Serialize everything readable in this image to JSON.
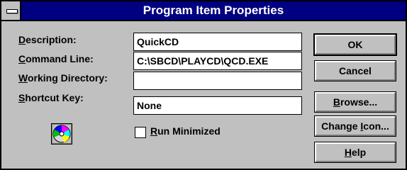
{
  "window": {
    "title": "Program Item Properties"
  },
  "labels": {
    "description": {
      "prefix": "",
      "hotkey": "D",
      "suffix": "escription:"
    },
    "command_line": {
      "prefix": "",
      "hotkey": "C",
      "suffix": "ommand Line:"
    },
    "working_directory": {
      "prefix": "",
      "hotkey": "W",
      "suffix": "orking Directory:"
    },
    "shortcut_key": {
      "prefix": "",
      "hotkey": "S",
      "suffix": "hortcut Key:"
    }
  },
  "fields": {
    "description": "QuickCD",
    "command_line": "C:\\SBCD\\PLAYCD\\QCD.EXE",
    "working_directory": "",
    "shortcut_key": "None"
  },
  "checkbox": {
    "checked": false,
    "prefix": "",
    "hotkey": "R",
    "suffix": "un Minimized"
  },
  "buttons": {
    "ok": "OK",
    "cancel": "Cancel",
    "browse": {
      "prefix": "",
      "hotkey": "B",
      "suffix": "rowse..."
    },
    "change_icon": {
      "prefix": "Change ",
      "hotkey": "I",
      "suffix": "con..."
    },
    "help": {
      "prefix": "",
      "hotkey": "H",
      "suffix": "elp"
    }
  },
  "icon": {
    "name": "cd-disc-icon"
  }
}
